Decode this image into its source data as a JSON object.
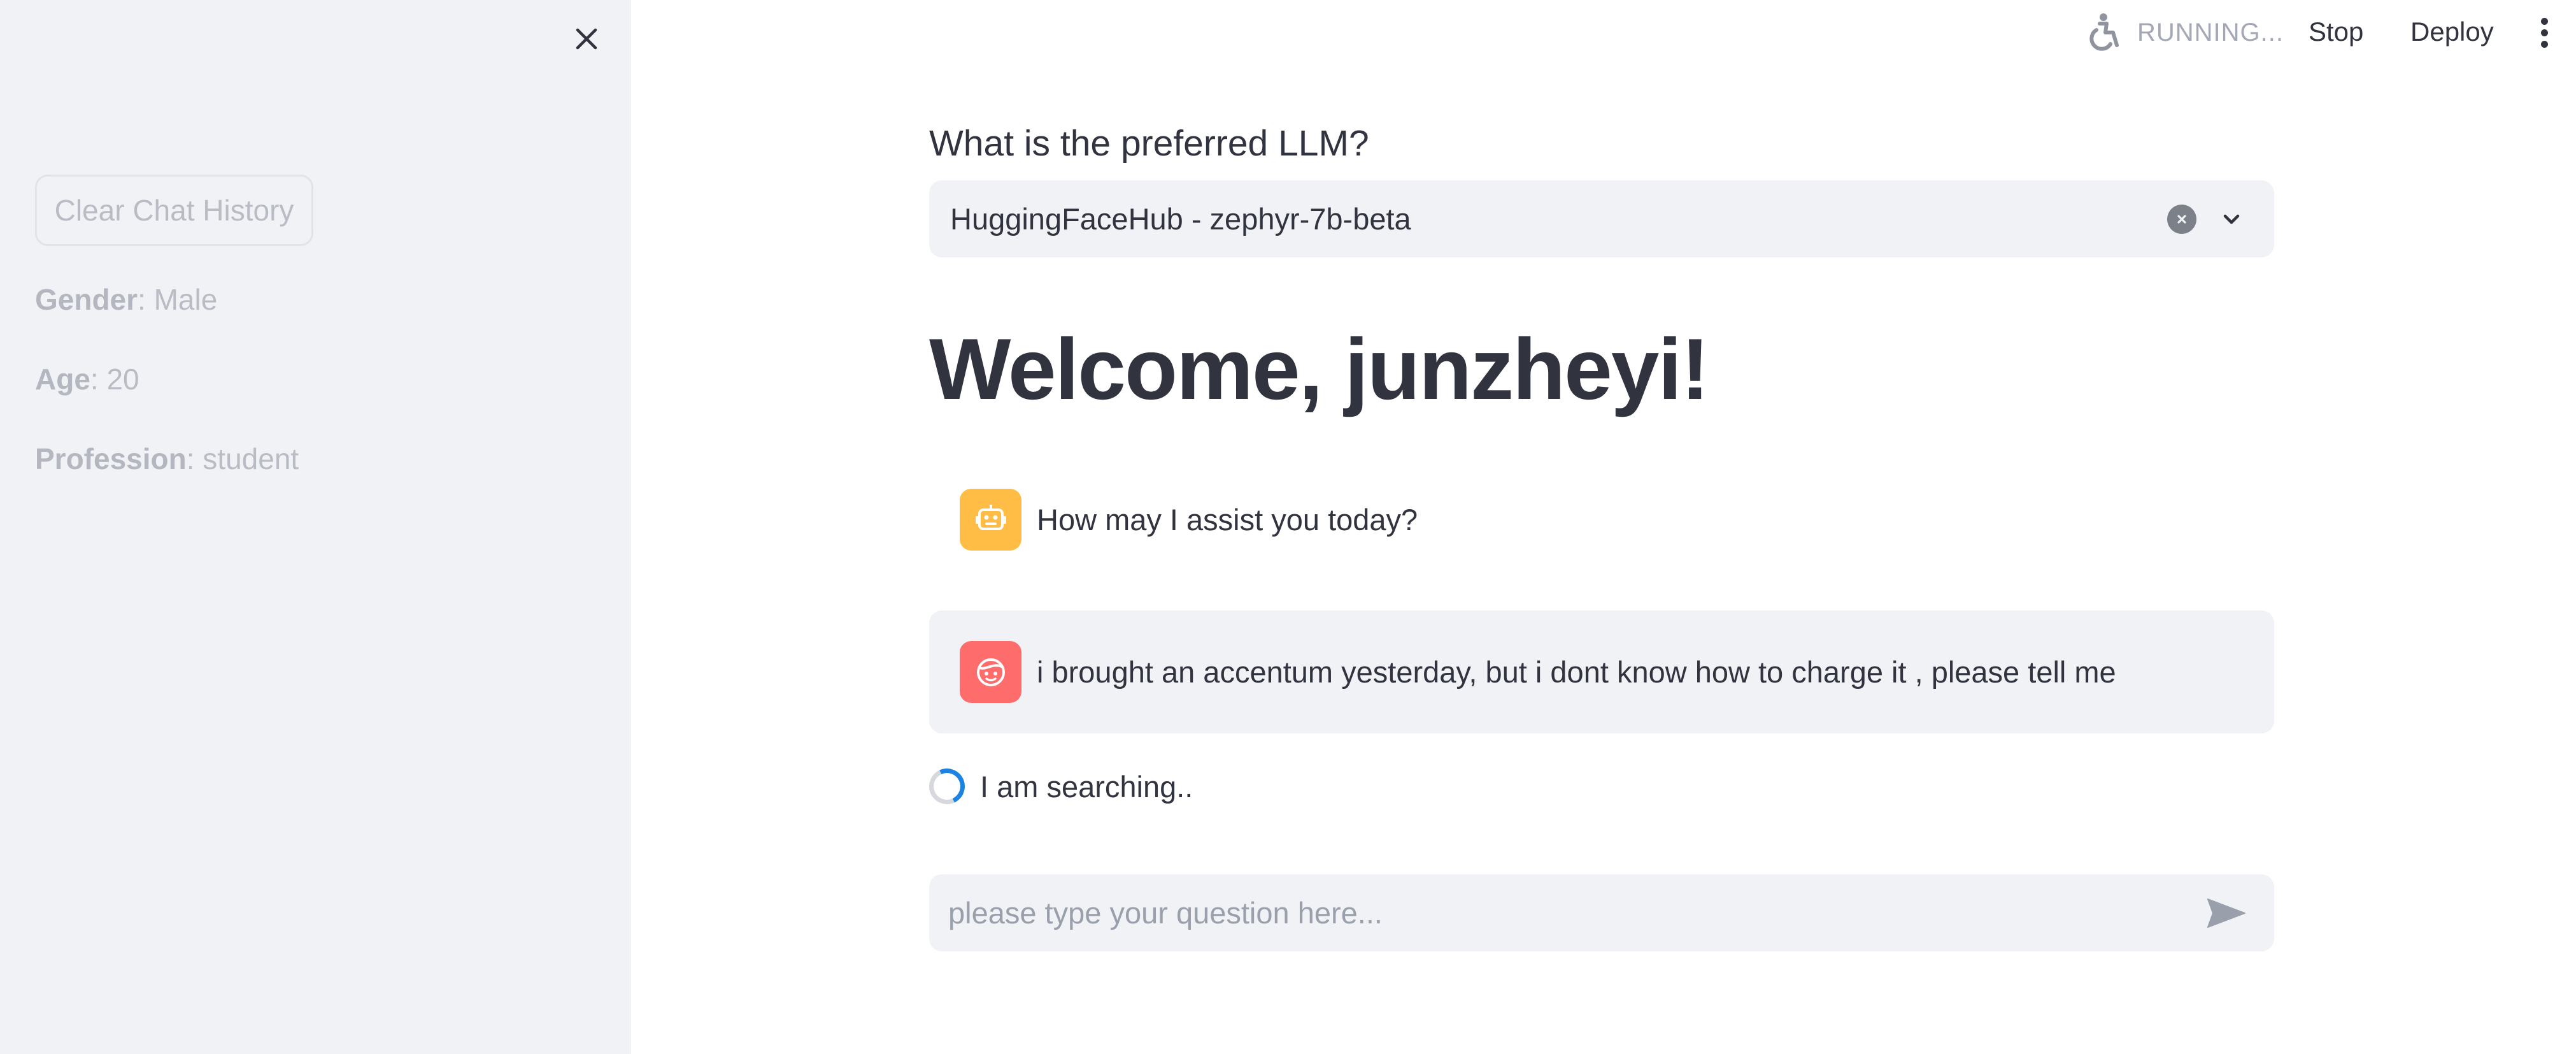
{
  "sidebar": {
    "clear_button_label": "Clear Chat History",
    "profile": [
      {
        "label": "Gender",
        "value": ": Male"
      },
      {
        "label": "Age",
        "value": ": 20"
      },
      {
        "label": "Profession",
        "value": ": student"
      }
    ]
  },
  "topbar": {
    "status_text": "RUNNING...",
    "stop_label": "Stop",
    "deploy_label": "Deploy"
  },
  "main": {
    "select_label": "What is the preferred LLM?",
    "selected_llm": "HuggingFaceHub - zephyr-7b-beta",
    "welcome_title": "Welcome, junzheyi!",
    "messages": [
      {
        "role": "assistant",
        "text": "How may I assist you today?"
      },
      {
        "role": "user",
        "text": "i brought an accentum yesterday, but i dont know how to charge it , please tell me"
      }
    ],
    "spinner_text": "I am searching..",
    "chat_input_placeholder": "please type your question here..."
  },
  "colors": {
    "sidebar_bg": "#f0f2f6",
    "bot_avatar": "#ffbd45",
    "user_avatar": "#ff6c6c",
    "spinner_accent": "#1c83e1",
    "text": "#31333f"
  },
  "icons": [
    "close-icon",
    "running-icon",
    "kebab-menu-icon",
    "clear-selection-icon",
    "chevron-down-icon",
    "bot-icon",
    "user-face-icon",
    "send-icon"
  ]
}
